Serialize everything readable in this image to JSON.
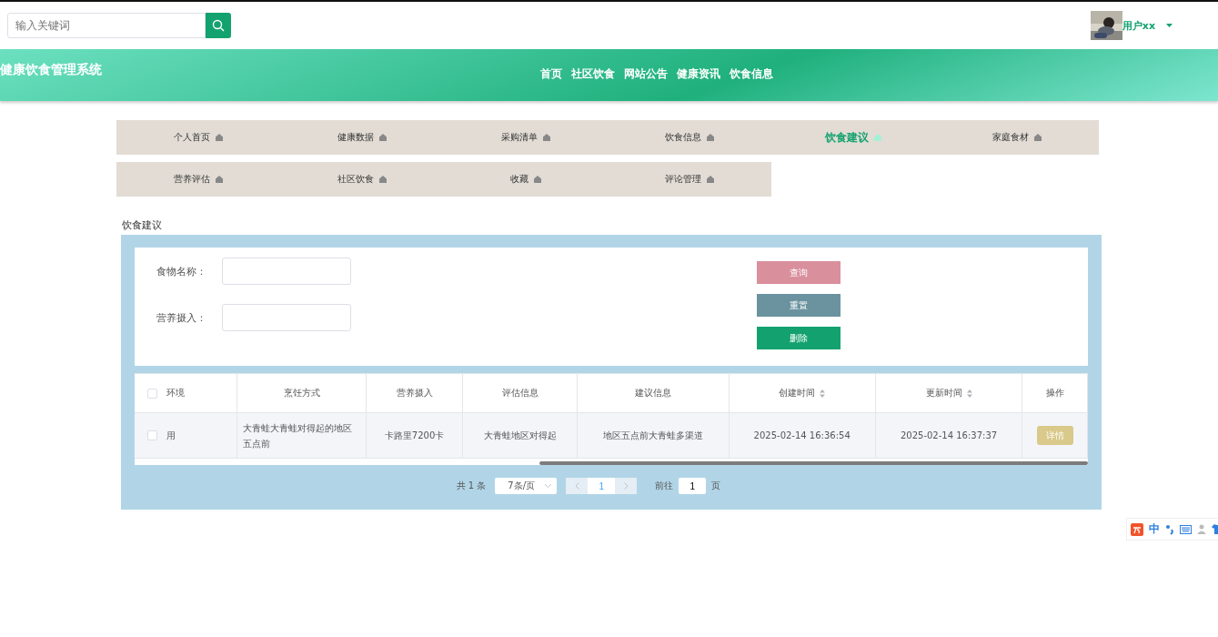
{
  "search": {
    "placeholder": "输入关键词"
  },
  "user": {
    "name": "用户xx"
  },
  "banner": {
    "title": "健康饮食管理系统",
    "nav": [
      {
        "label": "首页",
        "selected": false
      },
      {
        "label": "社区饮食",
        "selected": false
      },
      {
        "label": "网站公告",
        "selected": false
      },
      {
        "label": "健康资讯",
        "selected": false
      },
      {
        "label": "饮食信息",
        "selected": false
      }
    ]
  },
  "menu": {
    "rows": [
      [
        {
          "label": "个人首页",
          "selected": false
        },
        {
          "label": "健康数据",
          "selected": false
        },
        {
          "label": "采购清单",
          "selected": false
        },
        {
          "label": "饮食信息",
          "selected": false
        },
        {
          "label": "饮食建议",
          "selected": true
        },
        {
          "label": "家庭食材",
          "selected": false
        }
      ],
      [
        {
          "label": "营养评估",
          "selected": false
        },
        {
          "label": "社区饮食",
          "selected": false
        },
        {
          "label": "收藏",
          "selected": false
        },
        {
          "label": "评论管理",
          "selected": false
        }
      ]
    ]
  },
  "section_title": "饮食建议",
  "filters": [
    {
      "label": "食物名称："
    },
    {
      "label": "营养摄入："
    }
  ],
  "buttons": [
    {
      "label": "查询",
      "color": "#d98f9c"
    },
    {
      "label": "重置",
      "color": "#6a939f"
    },
    {
      "label": "删除",
      "color": "#13a26f"
    }
  ],
  "table": {
    "header_checked": false,
    "columns": [
      {
        "label": "环境",
        "sortable": false
      },
      {
        "label": "烹饪方式",
        "sortable": false
      },
      {
        "label": "营养摄入",
        "sortable": false
      },
      {
        "label": "评估信息",
        "sortable": false
      },
      {
        "label": "建议信息",
        "sortable": false
      },
      {
        "label": "创建时间",
        "sortable": true
      },
      {
        "label": "更新时间",
        "sortable": true
      },
      {
        "label": "操作",
        "sortable": false
      }
    ],
    "rows": [
      {
        "checked": false,
        "cells": [
          "用",
          "大青蛙大青蛙对得起的地区五点前",
          "卡路里7200卡",
          "大青蛙地区对得起",
          "地区五点前大青蛙多渠道",
          "2025-02-14 16:36:54",
          "2025-02-14 16:37:37"
        ],
        "action": "详情"
      }
    ]
  },
  "pagination": {
    "total": "共 1 条",
    "page_size": "7条/页",
    "pages": [
      {
        "label": "1",
        "selected": true
      }
    ],
    "goto_label": "前往",
    "goto_value": "1",
    "goto_unit": "页"
  },
  "ime": {
    "mode": "中"
  }
}
